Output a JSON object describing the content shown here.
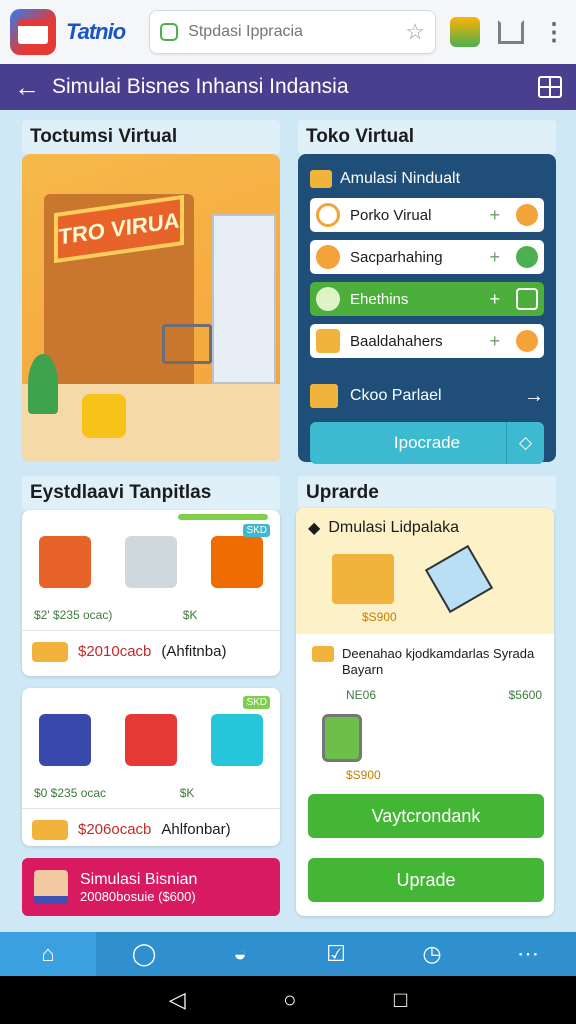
{
  "app": {
    "brand": "Tatnio",
    "search_placeholder": "Stpdasi Ippracia"
  },
  "header": {
    "title": "Simulai Bisnes Inhansi Indansia"
  },
  "sections": {
    "left_title": "Toctumsi Virtual",
    "right_title": "Toko Virtual",
    "left_title_2": "Eystdlaavi Tanpitlas",
    "right_title_2": "Uprarde"
  },
  "illustration": {
    "sign_text": "TRO VIRUA"
  },
  "toko_virtual": {
    "heading": "Amulasi Nindualt",
    "rows": [
      {
        "label": "Porko Virual",
        "plus": "+",
        "icon_color": "#f4a23a",
        "status_color": "#f4a23a"
      },
      {
        "label": "Sacparhahing",
        "plus": "+",
        "icon_color": "#f4a23a",
        "status_color": "#4caf50"
      },
      {
        "label": "Ehethins",
        "plus": "+",
        "icon_color": "#7fcf4a",
        "status_color": "#ffffff"
      },
      {
        "label": "Baaldahahers",
        "plus": "+",
        "icon_color": "#f2b33d",
        "status_color": "#f4a23a"
      }
    ],
    "cek_label": "Ckoo Parlael",
    "button_label": "Ipocrade"
  },
  "cards": [
    {
      "badge": "SKD",
      "prices": [
        "$2' $235 ocac)",
        "$K",
        ""
      ],
      "price": "$2010cacb",
      "label": "(Ahfitnba)"
    },
    {
      "badge": "SKD",
      "prices": [
        "$0 $235 ocac",
        "$K",
        ""
      ],
      "price": "$206ocacb",
      "label": "Ahlfonbar)"
    }
  ],
  "promo": {
    "title": "Simulasi Bisnian",
    "subtitle": "20080bosuie ($600)"
  },
  "upgrade": {
    "heading": "Dmulasi Lidpalaka",
    "price_1": "$S900",
    "desc": "Deenahao kjodkamdarlas Syrada Bayarn",
    "row_left": "NE06",
    "row_right": "$5600",
    "price_3": "$S900",
    "btn_primary": "Vaytcrondank",
    "btn_secondary": "Uprade"
  },
  "colors": {
    "header_bg": "#4a3e8f",
    "accent_green": "#44b636",
    "nav_bg": "#2f8fcf",
    "promo_bg": "#d81b60"
  },
  "nav": [
    "home-icon",
    "bulb-icon",
    "dome-icon",
    "check-icon",
    "clock-icon",
    "more-icon"
  ],
  "system_nav": [
    "back-icon",
    "home-circle-icon",
    "recents-icon"
  ]
}
